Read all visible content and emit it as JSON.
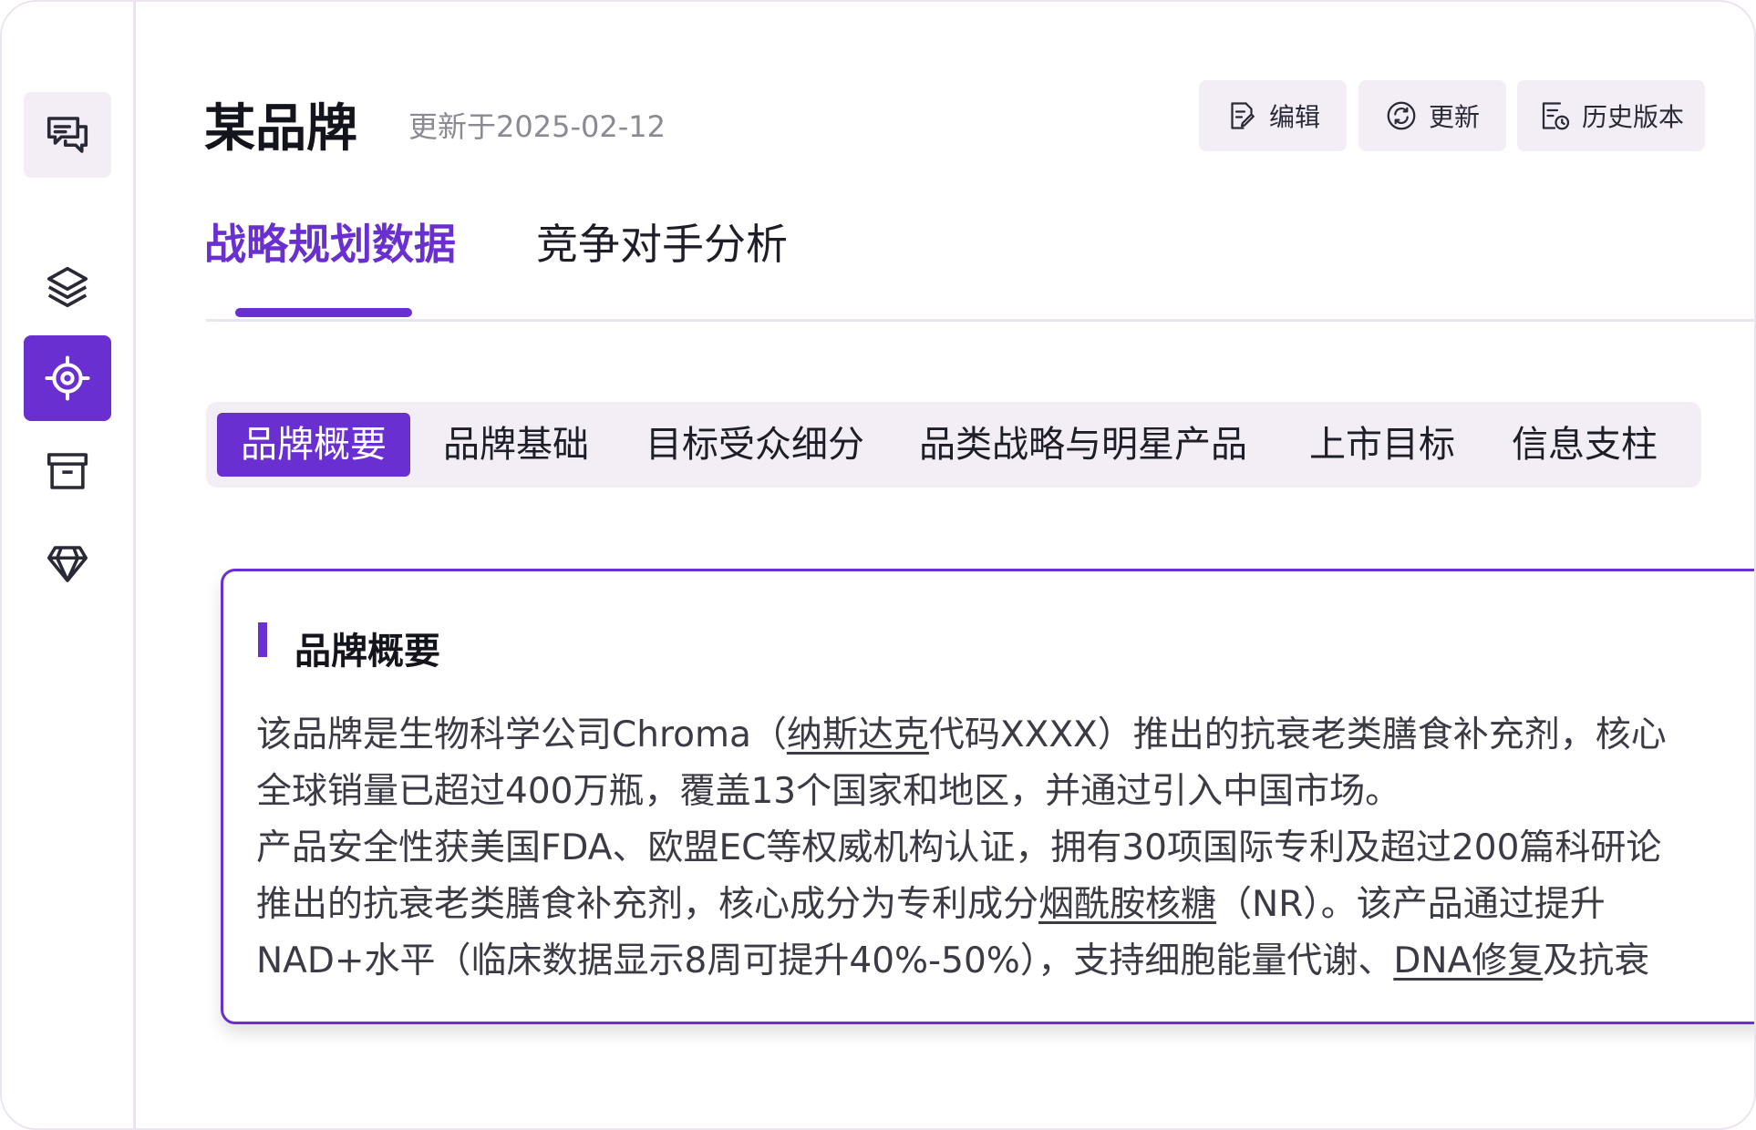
{
  "header": {
    "title": "某品牌",
    "updated": "更新于2025-02-12"
  },
  "actions": {
    "edit": "编辑",
    "refresh": "更新",
    "history": "历史版本"
  },
  "tabs": [
    {
      "label": "战略规划数据",
      "active": true
    },
    {
      "label": "竞争对手分析",
      "active": false
    }
  ],
  "subtabs": [
    {
      "label": "品牌概要",
      "active": true
    },
    {
      "label": "品牌基础",
      "active": false
    },
    {
      "label": "目标受众细分",
      "active": false
    },
    {
      "label": "品类战略与明星产品",
      "active": false
    },
    {
      "label": "上市目标",
      "active": false
    },
    {
      "label": "信息支柱",
      "active": false
    }
  ],
  "sidebar": {
    "icons": [
      "chat-icon",
      "layers-icon",
      "target-icon",
      "archive-icon",
      "gem-icon"
    ]
  },
  "card": {
    "title": "品牌概要",
    "p1_a": "该品牌是生物科学公司Chroma（",
    "p1_link": "纳斯达克",
    "p1_b": "代码XXXX）推出的抗衰老类膳食补充剂，核心",
    "p2": "全球销量已超过400万瓶，覆盖13个国家和地区，并通过引入中国市场。",
    "p3": "产品安全性获美国FDA、欧盟EC等权威机构认证，拥有30项国际专利及超过200篇科研论",
    "p4_a": "推出的抗衰老类膳食补充剂，核心成分为专利成分",
    "p4_link": "烟酰胺核糖",
    "p4_b": "（NR）。该产品通过提升",
    "p5_a": "NAD+水平（临床数据显示8周可提升40%-50%），支持细胞能量代谢、",
    "p5_link": "DNA修复",
    "p5_b": "及抗衰"
  },
  "colors": {
    "accent": "#6a2fd0",
    "soft": "#f3eef6",
    "border": "#ece3f1"
  }
}
